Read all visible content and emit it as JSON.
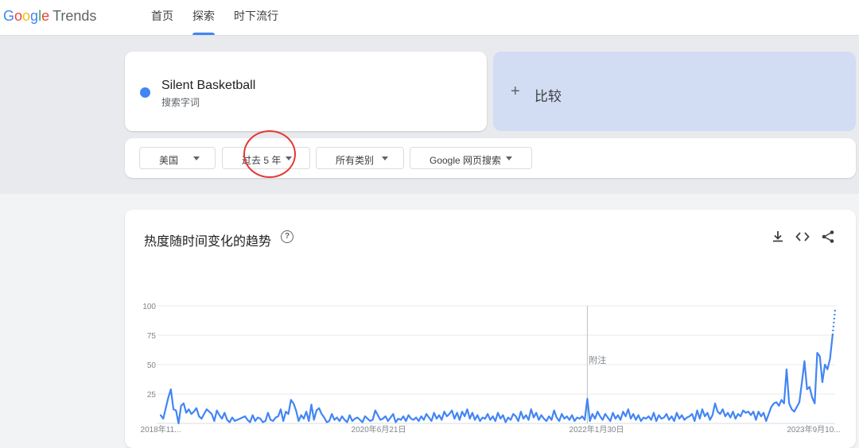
{
  "header": {
    "logo": {
      "google": "Google",
      "product": "Trends"
    },
    "tabs": [
      {
        "label": "首页"
      },
      {
        "label": "探索",
        "active": true
      },
      {
        "label": "时下流行"
      }
    ]
  },
  "term": {
    "name": "Silent Basketball",
    "type": "搜索字词",
    "color": "#4285f4"
  },
  "compare": {
    "plus": "+",
    "label": "比较"
  },
  "filters": {
    "region": "美国",
    "time": "过去 5 年",
    "category": "所有类别",
    "search_type": "Google 网页搜索"
  },
  "chart_card": {
    "title": "热度随时间变化的趋势",
    "help": "?",
    "icons": [
      "download-icon",
      "embed-icon",
      "share-icon"
    ]
  },
  "chart_data": {
    "type": "line",
    "series": [
      {
        "color": "#4285f4",
        "values": [
          7,
          4,
          13,
          22,
          29,
          12,
          11,
          0,
          15,
          17,
          9,
          12,
          8,
          10,
          13,
          6,
          4,
          8,
          12,
          10,
          8,
          2,
          11,
          7,
          4,
          9,
          3,
          1,
          5,
          2,
          3,
          4,
          5,
          6,
          3,
          1,
          7,
          2,
          5,
          4,
          1,
          2,
          9,
          3,
          2,
          5,
          6,
          12,
          2,
          10,
          8,
          20,
          17,
          11,
          2,
          7,
          4,
          10,
          2,
          16,
          3,
          11,
          13,
          8,
          5,
          1,
          2,
          8,
          3,
          5,
          2,
          6,
          3,
          1,
          7,
          2,
          4,
          5,
          3,
          1,
          6,
          4,
          2,
          3,
          11,
          7,
          3,
          4,
          6,
          2,
          5,
          8,
          1,
          4,
          3,
          6,
          2,
          7,
          4,
          3,
          5,
          2,
          6,
          3,
          8,
          5,
          2,
          9,
          4,
          7,
          3,
          10,
          6,
          8,
          11,
          4,
          9,
          3,
          10,
          6,
          12,
          4,
          9,
          3,
          7,
          2,
          5,
          4,
          8,
          3,
          6,
          2,
          9,
          4,
          7,
          1,
          5,
          3,
          8,
          6,
          2,
          10,
          4,
          7,
          3,
          12,
          5,
          9,
          3,
          7,
          4,
          2,
          6,
          3,
          11,
          5,
          2,
          8,
          4,
          6,
          3,
          7,
          2,
          5,
          4,
          6,
          3,
          21,
          2,
          8,
          4,
          10,
          6,
          3,
          8,
          5,
          2,
          9,
          4,
          7,
          3,
          10,
          6,
          12,
          4,
          8,
          3,
          7,
          2,
          5,
          4,
          6,
          3,
          9,
          2,
          7,
          4,
          5,
          8,
          3,
          6,
          2,
          9,
          4,
          7,
          3,
          5,
          6,
          8,
          2,
          11,
          4,
          12,
          6,
          9,
          3,
          7,
          17,
          10,
          8,
          12,
          6,
          9,
          5,
          10,
          4,
          8,
          6,
          11,
          9,
          10,
          7,
          10,
          3,
          10,
          6,
          9,
          2,
          8,
          14,
          17,
          18,
          15,
          20,
          17,
          46,
          17,
          12,
          10,
          14,
          18,
          35,
          53,
          29,
          31,
          22,
          17,
          60,
          57,
          35,
          50,
          46,
          55,
          75
        ],
        "partial_values": [
          75,
          97
        ]
      }
    ],
    "x_tick_labels": [
      "2018年11...",
      "2020年6月21日",
      "2022年1月30日",
      "2023年9月10..."
    ],
    "y_ticks": [
      100,
      75,
      50,
      25
    ],
    "ylim": [
      0,
      100
    ],
    "annotation": {
      "text": "附注",
      "x_index": 167
    },
    "grid": true
  }
}
